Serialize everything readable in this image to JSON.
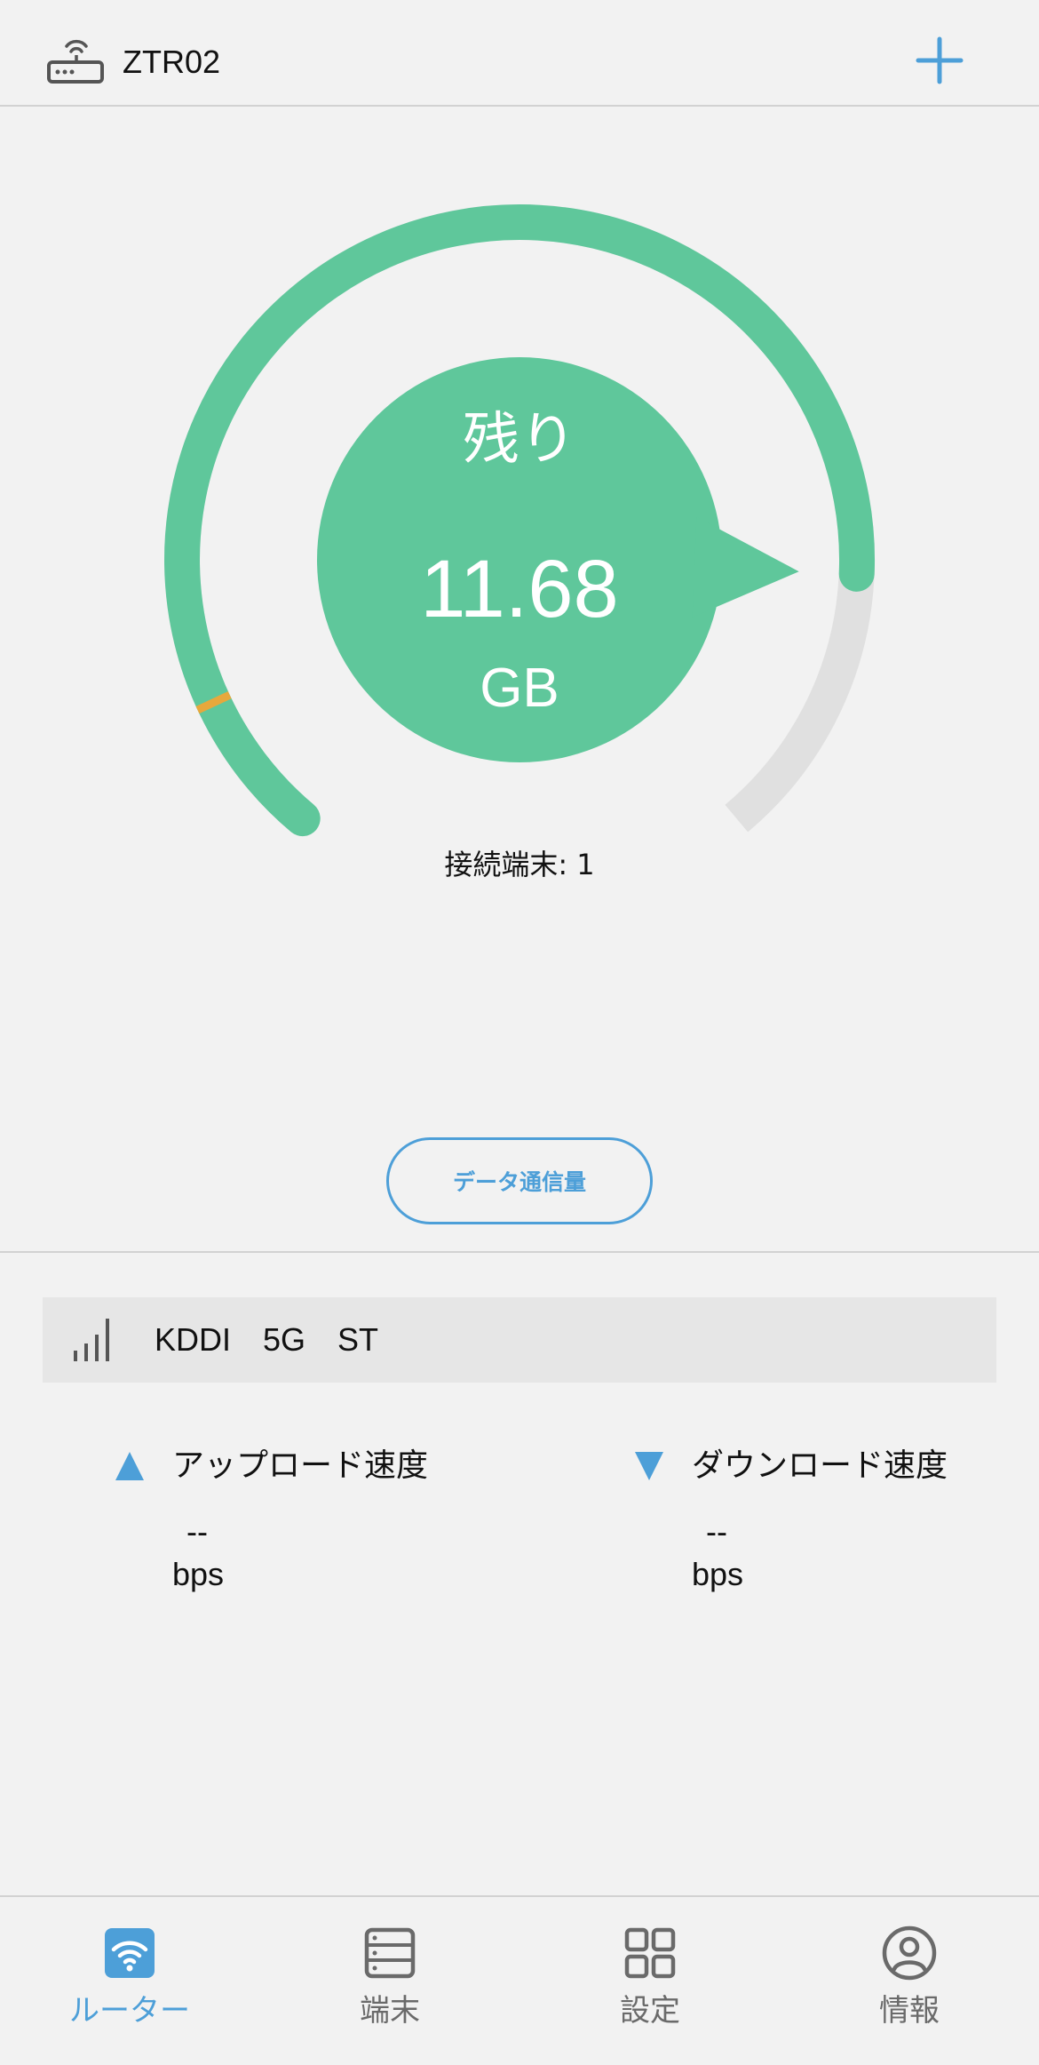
{
  "header": {
    "device_name": "ZTR02",
    "router_icon": "router-icon",
    "add_icon": "plus-icon"
  },
  "gauge": {
    "title": "残り",
    "value": "11.68",
    "unit": "GB",
    "connected_label": "接続端末: 1",
    "fill_fraction": 0.83,
    "colors": {
      "fill": "#5fc79b",
      "track": "#e0e0e0",
      "marker": "#e7a83c"
    }
  },
  "data_usage_button": "データ通信量",
  "network": {
    "carrier": "KDDI",
    "mode": "5G",
    "status": "ST",
    "icon": "signal-icon"
  },
  "speeds": {
    "upload": {
      "label": "アップロード速度",
      "value": "--",
      "unit": "bps"
    },
    "download": {
      "label": "ダウンロード速度",
      "value": "--",
      "unit": "bps"
    }
  },
  "tabs": [
    {
      "label": "ルーター",
      "icon": "wifi-icon",
      "active": true
    },
    {
      "label": "端末",
      "icon": "device-list-icon",
      "active": false
    },
    {
      "label": "設定",
      "icon": "grid-icon",
      "active": false
    },
    {
      "label": "情報",
      "icon": "user-circle-icon",
      "active": false
    }
  ],
  "colors": {
    "accent": "#4d9fd8",
    "green": "#5fc79b",
    "text": "#111111"
  }
}
